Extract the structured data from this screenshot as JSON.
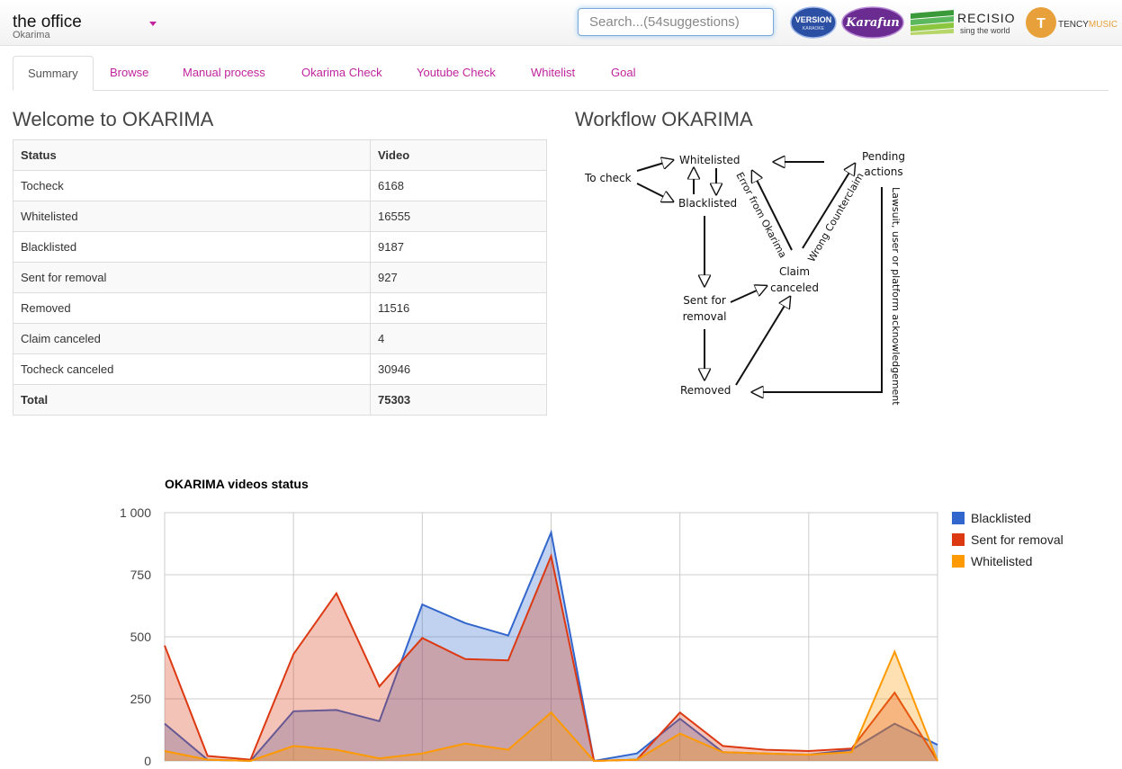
{
  "app": {
    "title": "the office",
    "subtitle": "Okarima"
  },
  "search": {
    "placeholder": "Search...(54suggestions)"
  },
  "logos": [
    {
      "name": "version-karaoke",
      "line1": "VERSION",
      "line2": "KARAOKE"
    },
    {
      "name": "karafun",
      "text": "Karafun"
    },
    {
      "name": "recisio",
      "text": "RECISIO",
      "tagline": "sing the world"
    },
    {
      "name": "tencymusic",
      "text1": "TENCY",
      "text2": "MUSIC"
    }
  ],
  "tabs": [
    "Summary",
    "Browse",
    "Manual process",
    "Okarima Check",
    "Youtube Check",
    "Whitelist",
    "Goal"
  ],
  "welcome": {
    "heading": "Welcome to OKARIMA",
    "table": {
      "headers": [
        "Status",
        "Video"
      ],
      "rows": [
        [
          "Tocheck",
          "6168"
        ],
        [
          "Whitelisted",
          "16555"
        ],
        [
          "Blacklisted",
          "9187"
        ],
        [
          "Sent for removal",
          "927"
        ],
        [
          "Removed",
          "11516"
        ],
        [
          "Claim canceled",
          "4"
        ],
        [
          "Tocheck canceled",
          "30946"
        ]
      ],
      "total": [
        "Total",
        "75303"
      ]
    }
  },
  "workflow": {
    "heading": "Workflow OKARIMA",
    "nodes": {
      "to_check": "To check",
      "whitelisted": "Whitelisted",
      "blacklisted": "Blacklisted",
      "pending_line1": "Pending",
      "pending_line2": "actions",
      "claim_line1": "Claim",
      "claim_line2": "canceled",
      "sent_line1": "Sent for",
      "sent_line2": "removal",
      "removed": "Removed"
    },
    "edge_labels": {
      "error": "Error from Okarima",
      "counterclaim": "Wrong Counterclaim",
      "lawsuit": "Lawsuit, user or platform acknowledgement"
    },
    "colors": {
      "error": "#2e7d1a",
      "counterclaim": "#e02020",
      "lawsuit": "#f07a10"
    }
  },
  "chart_data": {
    "type": "area",
    "title": "OKARIMA videos status",
    "yticks": [
      "1 000",
      "750",
      "500",
      "250",
      "0"
    ],
    "ylim": [
      0,
      1000
    ],
    "grid": true,
    "legend_position": "right",
    "series": [
      {
        "name": "Blacklisted",
        "color": "#3366cc",
        "values": [
          150,
          5,
          0,
          200,
          205,
          160,
          630,
          555,
          505,
          920,
          0,
          30,
          170,
          35,
          30,
          25,
          45,
          150,
          65
        ]
      },
      {
        "name": "Sent for removal",
        "color": "#dc3912",
        "values": [
          465,
          20,
          5,
          430,
          675,
          300,
          495,
          410,
          405,
          825,
          0,
          5,
          195,
          60,
          45,
          40,
          50,
          275,
          0
        ]
      },
      {
        "name": "Whitelisted",
        "color": "#ff9900",
        "values": [
          40,
          5,
          0,
          60,
          45,
          10,
          30,
          70,
          45,
          195,
          0,
          5,
          110,
          35,
          30,
          25,
          35,
          440,
          0
        ]
      }
    ]
  }
}
